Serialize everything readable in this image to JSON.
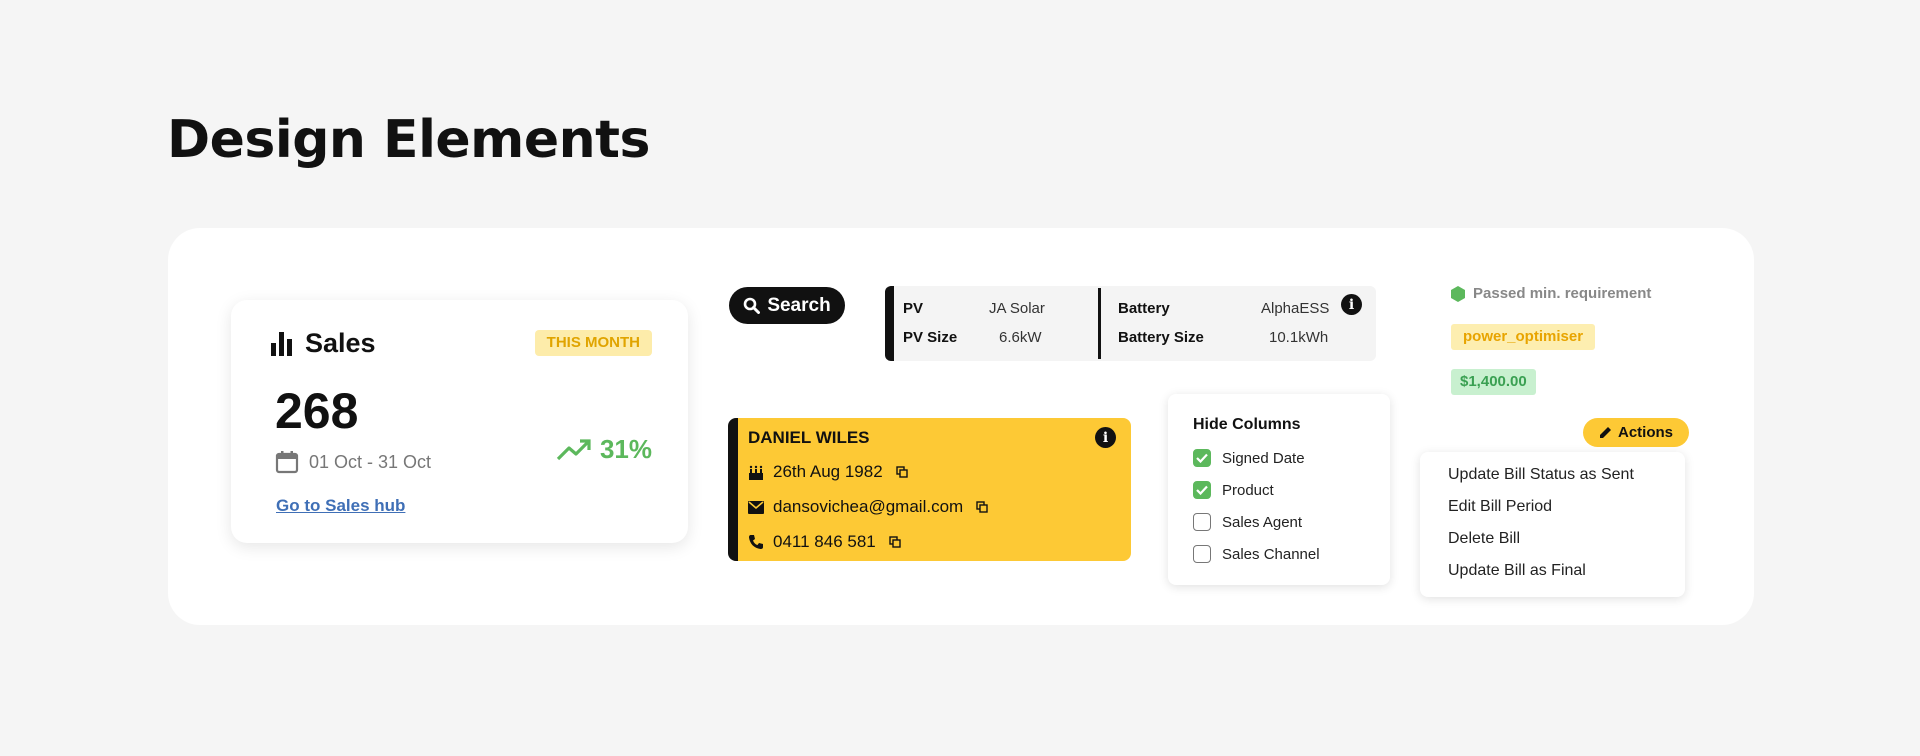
{
  "page": {
    "title": "Design Elements"
  },
  "sales": {
    "title": "Sales",
    "badge": "THIS MONTH",
    "value": "268",
    "date_range": "01 Oct - 31 Oct",
    "trend": "31%",
    "link": "Go to Sales hub",
    "icons": [
      "bar-chart-icon",
      "calendar-icon",
      "trending-up-icon"
    ]
  },
  "search": {
    "label": "Search",
    "icon": "search-icon"
  },
  "system": {
    "pv_label": "PV",
    "pv_value": "JA Solar",
    "pv_size_label": "PV Size",
    "pv_size_value": "6.6kW",
    "battery_label": "Battery",
    "battery_value": "AlphaESS",
    "battery_size_label": "Battery Size",
    "battery_size_value": "10.1kWh"
  },
  "contact": {
    "name": "DANIEL WILES",
    "birthday": "26th Aug 1982",
    "email": "dansovichea@gmail.com",
    "phone": "0411 846 581"
  },
  "hide_columns": {
    "title": "Hide Columns",
    "options": [
      {
        "label": "Signed Date",
        "checked": true
      },
      {
        "label": "Product",
        "checked": true
      },
      {
        "label": "Sales Agent",
        "checked": false
      },
      {
        "label": "Sales Channel",
        "checked": false
      }
    ]
  },
  "status": {
    "requirement": "Passed min. requirement",
    "tag": "power_optimiser",
    "amount": "$1,400.00"
  },
  "actions": {
    "label": "Actions",
    "items": [
      "Update Bill Status as Sent",
      "Edit Bill Period",
      "Delete Bill",
      "Update Bill as Final"
    ]
  },
  "colors": {
    "accent_yellow": "#fdc935",
    "success_green": "#5cb85c",
    "link_blue": "#3f6fb6",
    "dark": "#111111"
  }
}
